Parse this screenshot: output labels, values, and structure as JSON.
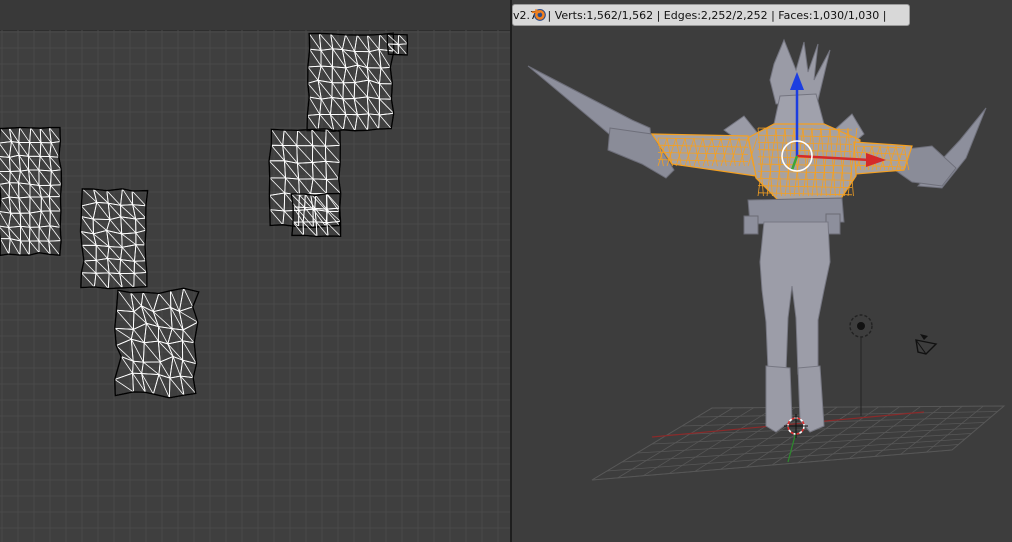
{
  "app": {
    "name": "Blender"
  },
  "info_header": {
    "stats": "v2.75 | Verts:1,562/1,562 | Edges:2,252/2,252 | Faces:1,030/1,030 |"
  },
  "colors": {
    "uv_background": "#3f3f3f",
    "viewport_background": "#3d3d3d",
    "selection_orange": "#f5a020",
    "mesh_grey": "#9a9ba6",
    "axis_x_red": "#d42a2a",
    "axis_y_green": "#3aa636",
    "axis_z_blue": "#1c3ee0"
  },
  "icons": [
    "blender-logo-icon",
    "lamp-icon",
    "camera-icon",
    "3d-cursor-icon",
    "manipulator-widget-icon"
  ]
}
